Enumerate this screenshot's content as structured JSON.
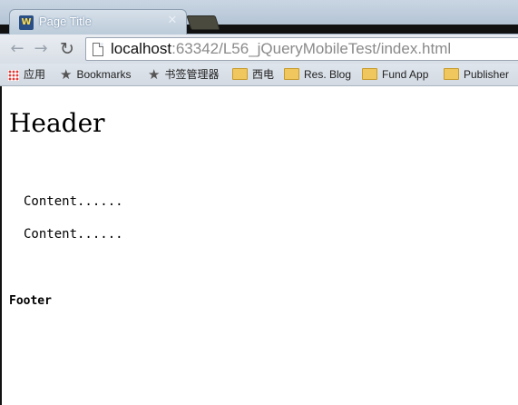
{
  "browser": {
    "tab": {
      "title": "Page Title",
      "close_glyph": "✕",
      "favicon": "webstorm-icon"
    },
    "nav": {
      "back_glyph": "←",
      "forward_glyph": "→",
      "reload_glyph": "↻"
    },
    "address": {
      "host": "localhost",
      "path": ":63342/L56_jQueryMobileTest/index.html"
    },
    "bookmarks": [
      {
        "label": "应用",
        "icon": "apps-icon"
      },
      {
        "label": "Bookmarks",
        "icon": "star-icon"
      },
      {
        "label": "书签管理器",
        "icon": "star-icon"
      },
      {
        "label": "西电",
        "icon": "folder-icon"
      },
      {
        "label": "Res. Blog",
        "icon": "folder-icon"
      },
      {
        "label": "Fund App",
        "icon": "folder-icon"
      },
      {
        "label": "Publisher",
        "icon": "folder-icon"
      }
    ]
  },
  "page": {
    "header": "Header",
    "content": [
      "Content......",
      "Content......"
    ],
    "footer": "Footer"
  }
}
